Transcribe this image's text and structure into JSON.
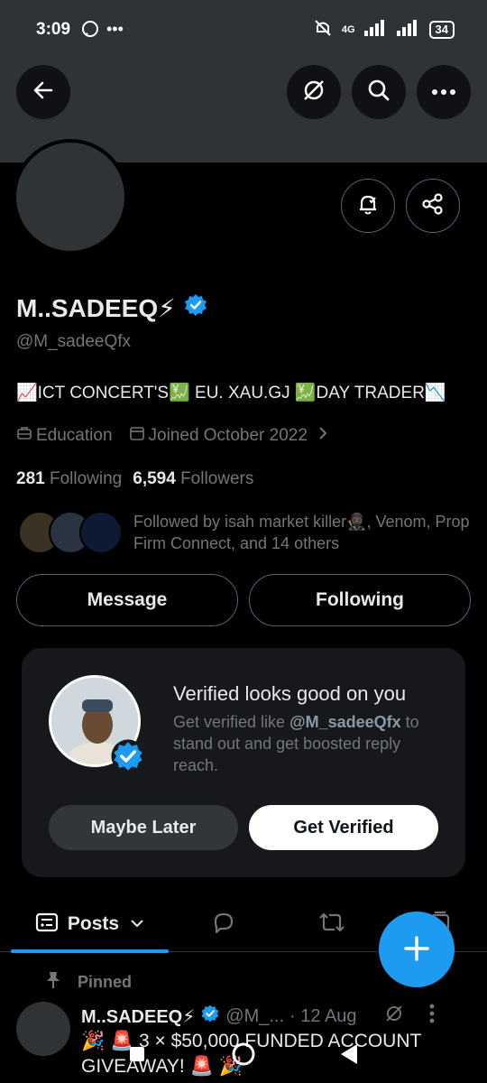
{
  "status_bar": {
    "time": "3:09",
    "extra_icons": [
      "whatsapp-icon",
      "more-dots"
    ],
    "network": "4G",
    "battery": "34"
  },
  "profile": {
    "display_name": "M..SADEEQ⚡",
    "handle": "@M_sadeeQfx",
    "bio": "📈ICT CONCERT'S💹 EU. XAU.GJ 💹DAY TRADER📉",
    "category": "Education",
    "joined": "Joined October 2022",
    "following_count": "281",
    "following_label": "Following",
    "followers_count": "6,594",
    "followers_label": "Followers",
    "followed_by": "Followed by isah market killer🥷🏿, Venom, Prop Firm Connect, and 14 others"
  },
  "actions": {
    "message_label": "Message",
    "following_label": "Following"
  },
  "verify_card": {
    "title": "Verified looks good on you",
    "text_prefix": "Get verified like ",
    "text_handle": "@M_sadeeQfx",
    "text_suffix": " to stand out and get boosted reply reach.",
    "maybe_later": "Maybe Later",
    "get_verified": "Get Verified"
  },
  "tabs": {
    "posts_label": "Posts"
  },
  "pinned_post": {
    "pinned_label": "Pinned",
    "author": "M..SADEEQ⚡",
    "handle": "@M_...",
    "date": "· 12 Aug",
    "text": "🎉 🚨 3 × $50,000 FUNDED ACCOUNT GIVEAWAY! 🚨 🎉"
  },
  "colors": {
    "accent": "#1d9bf0",
    "background": "#000000",
    "card": "#16181c",
    "muted_text": "#71767b"
  }
}
